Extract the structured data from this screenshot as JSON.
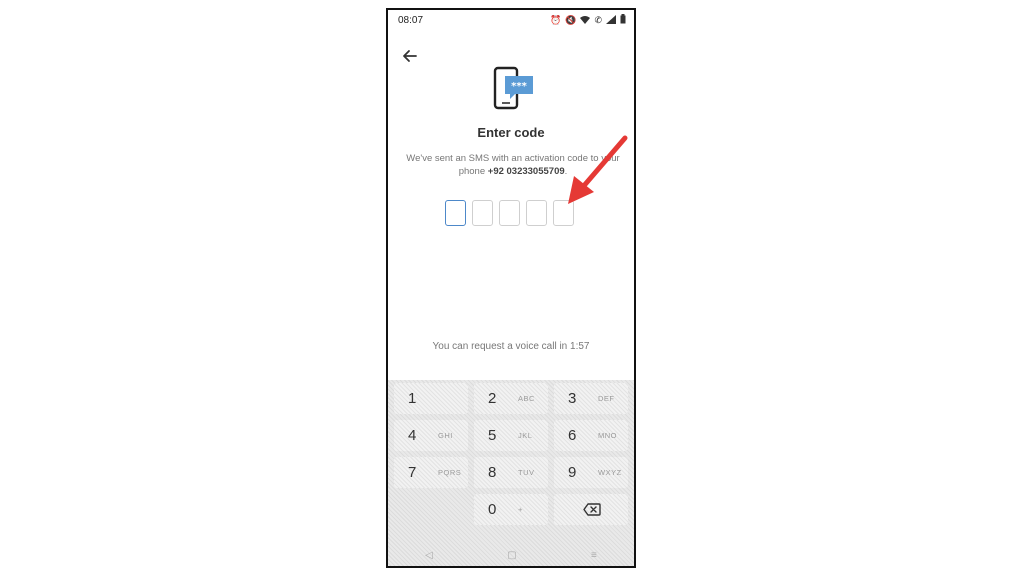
{
  "status_bar": {
    "time": "08:07",
    "icons": [
      "alarm-icon",
      "mute-icon",
      "wifi-call-icon",
      "call-icon",
      "signal-icon",
      "battery-icon"
    ]
  },
  "screen": {
    "title": "Enter code",
    "subtitle_prefix": "We've sent an SMS with an activation code to your phone ",
    "phone_number": "+92 03233055709",
    "subtitle_suffix": ".",
    "code_length": 5,
    "voice_call_text": "You can request a voice call in 1:57"
  },
  "keypad": {
    "keys": [
      {
        "digit": "1",
        "letters": ""
      },
      {
        "digit": "2",
        "letters": "ABC"
      },
      {
        "digit": "3",
        "letters": "DEF"
      },
      {
        "digit": "4",
        "letters": "GHI"
      },
      {
        "digit": "5",
        "letters": "JKL"
      },
      {
        "digit": "6",
        "letters": "MNO"
      },
      {
        "digit": "7",
        "letters": "PQRS"
      },
      {
        "digit": "8",
        "letters": "TUV"
      },
      {
        "digit": "9",
        "letters": "WXYZ"
      },
      {
        "digit": "0",
        "letters": "+"
      }
    ],
    "backspace_icon": "backspace-icon"
  },
  "nav_bar": {
    "back": "◁",
    "home": "▢",
    "recents": "≡"
  },
  "colors": {
    "accent": "#4d88c9",
    "annotation_arrow": "#e53935"
  }
}
